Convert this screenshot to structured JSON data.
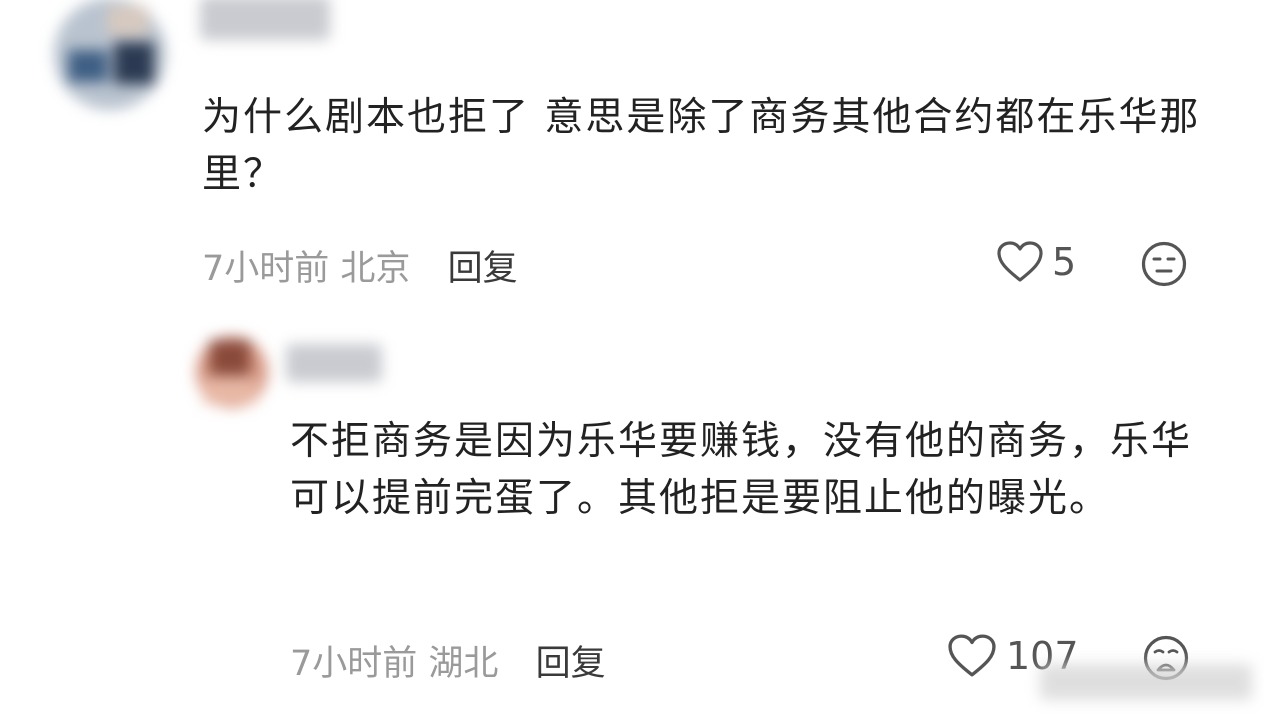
{
  "comments": [
    {
      "text": "为什么剧本也拒了 意思是除了商务其他合约都在乐华那里？",
      "time": "7小时前",
      "location": "北京",
      "reply_label": "回复",
      "likes": "5",
      "reaction_icon": "neutral-face-icon"
    },
    {
      "text": "不拒商务是因为乐华要赚钱，没有他的商务，乐华可以提前完蛋了。其他拒是要阻止他的曝光。",
      "time": "7小时前",
      "location": "湖北",
      "reply_label": "回复",
      "likes": "107",
      "reaction_icon": "crying-face-icon"
    }
  ],
  "colors": {
    "text": "#222222",
    "meta": "#9a9a9a",
    "icon": "#555555"
  }
}
